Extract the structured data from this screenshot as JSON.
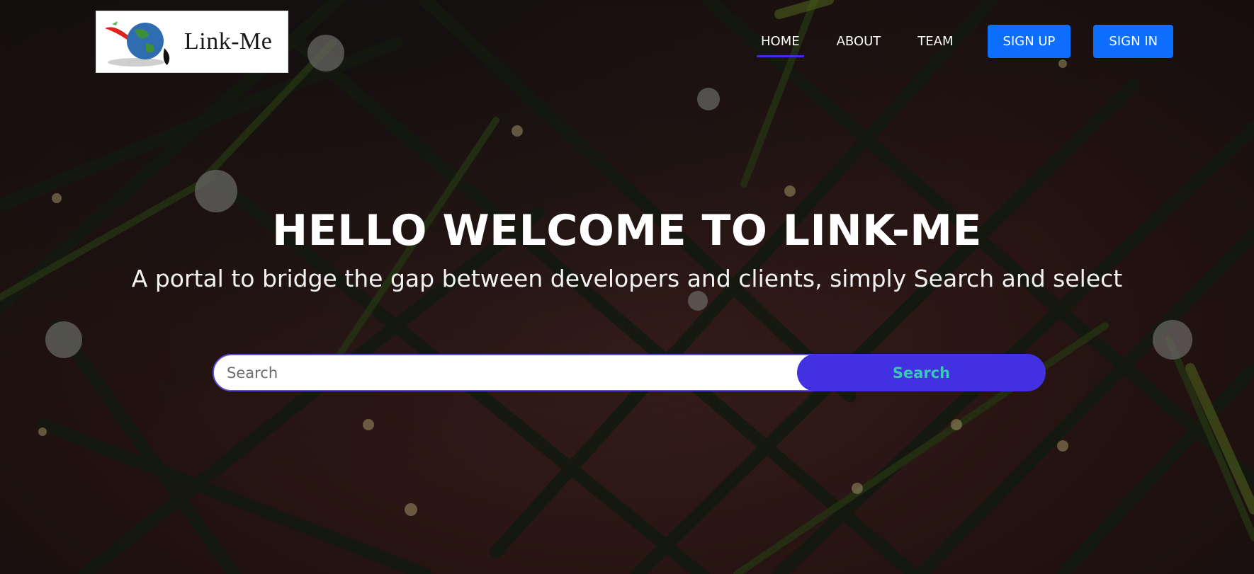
{
  "brand": {
    "name": "Link-Me",
    "logo_icon": "globe-swoosh-logo"
  },
  "nav": {
    "links": [
      {
        "label": "HOME",
        "active": true
      },
      {
        "label": "ABOUT",
        "active": false
      },
      {
        "label": "TEAM",
        "active": false
      }
    ],
    "signup_label": "SIGN UP",
    "signin_label": "SIGN IN"
  },
  "hero": {
    "title": "HELLO WELCOME TO LINK-ME",
    "subtitle": "A portal to bridge the gap between developers and clients, simply Search and select"
  },
  "search": {
    "placeholder": "Search",
    "value": "",
    "button_label": "Search"
  },
  "colors": {
    "accent": "#4131e0",
    "button_blue": "#0d6efd",
    "search_text": "#3ac7b5",
    "background": "#2c1714"
  }
}
